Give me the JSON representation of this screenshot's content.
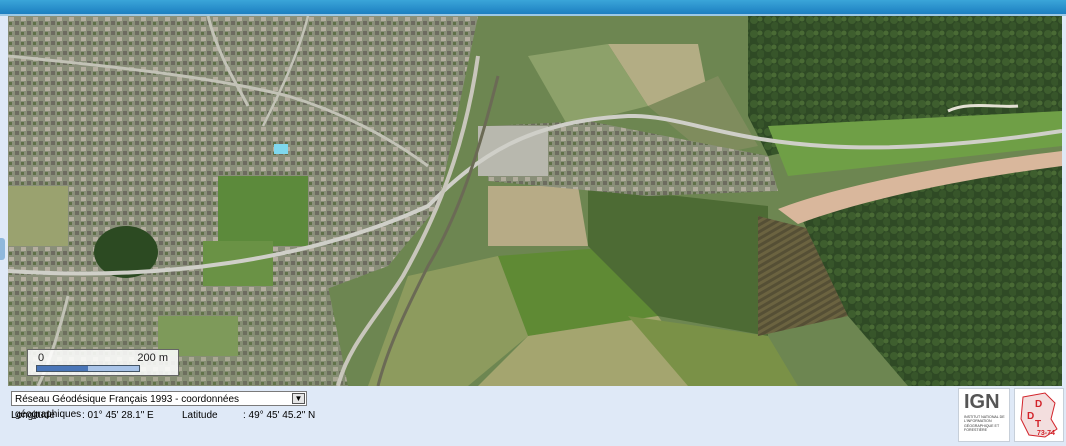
{
  "map": {
    "scale": {
      "start": "0",
      "distance": "200 m"
    }
  },
  "panel": {
    "crs_selected": "Réseau Géodésique Français 1993 - coordonnées géographiques",
    "longitude_label": "Longitude",
    "longitude_value": ": 01° 45' 28.1\" E",
    "latitude_label": "Latitude",
    "latitude_value": ": 49° 45' 45.2\" N"
  },
  "logos": {
    "ign": "IGN",
    "ign_caption": "INSTITUT NATIONAL DE L'INFORMATION GÉOGRAPHIQUE ET FORESTIÈRE",
    "ddt": "DDT 73-74"
  },
  "colors": {
    "header_bar": "#1d7fc0",
    "panel_bg": "#dfe9f7",
    "ddt_red": "#d2232a"
  }
}
